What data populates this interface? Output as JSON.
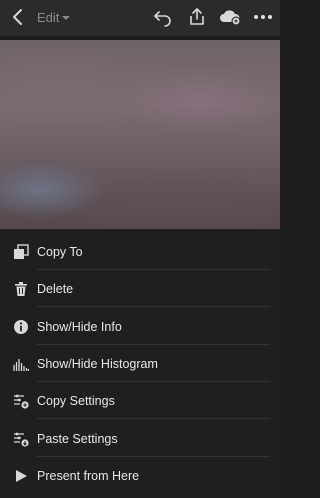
{
  "header": {
    "edit_label": "Edit",
    "icons": [
      "back-icon",
      "undo-icon",
      "share-icon",
      "cloud-sync-icon",
      "more-icon"
    ]
  },
  "menu": {
    "items": [
      {
        "label": "Copy To",
        "icon": "copy-to-icon"
      },
      {
        "label": "Delete",
        "icon": "trash-icon"
      },
      {
        "label": "Show/Hide Info",
        "icon": "info-icon"
      },
      {
        "label": "Show/Hide Histogram",
        "icon": "histogram-icon"
      },
      {
        "label": "Copy Settings",
        "icon": "copy-settings-icon"
      },
      {
        "label": "Paste Settings",
        "icon": "paste-settings-icon"
      },
      {
        "label": "Present from Here",
        "icon": "play-icon"
      }
    ]
  }
}
